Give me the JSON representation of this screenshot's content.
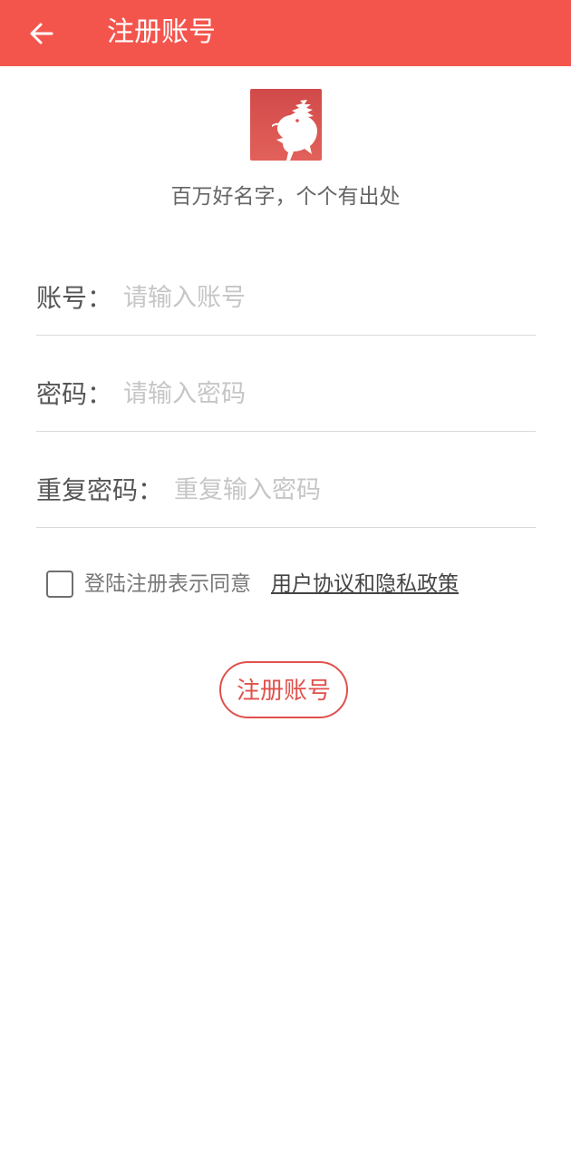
{
  "header": {
    "back_icon": "arrow-left-icon",
    "title": "注册账号"
  },
  "logo": {
    "icon": "dragon-logo-icon",
    "colors": {
      "top": "#d14a4a",
      "bottom": "#e2615a",
      "figure": "#ffffff"
    }
  },
  "slogan": "百万好名字，个个有出处",
  "form": {
    "account": {
      "label": "账号：",
      "placeholder": "请输入账号",
      "value": ""
    },
    "password": {
      "label": "密码：",
      "placeholder": "请输入密码",
      "value": ""
    },
    "confirm_password": {
      "label": "重复密码：",
      "placeholder": "重复输入密码",
      "value": ""
    }
  },
  "agreement": {
    "checked": false,
    "text": "登陆注册表示同意",
    "link": "用户协议和隐私政策"
  },
  "submit": {
    "label": "注册账号"
  },
  "colors": {
    "header_bg": "#f3554d",
    "accent": "#e0514c",
    "divider": "#d9d9d9",
    "placeholder": "#c6c6c6"
  }
}
